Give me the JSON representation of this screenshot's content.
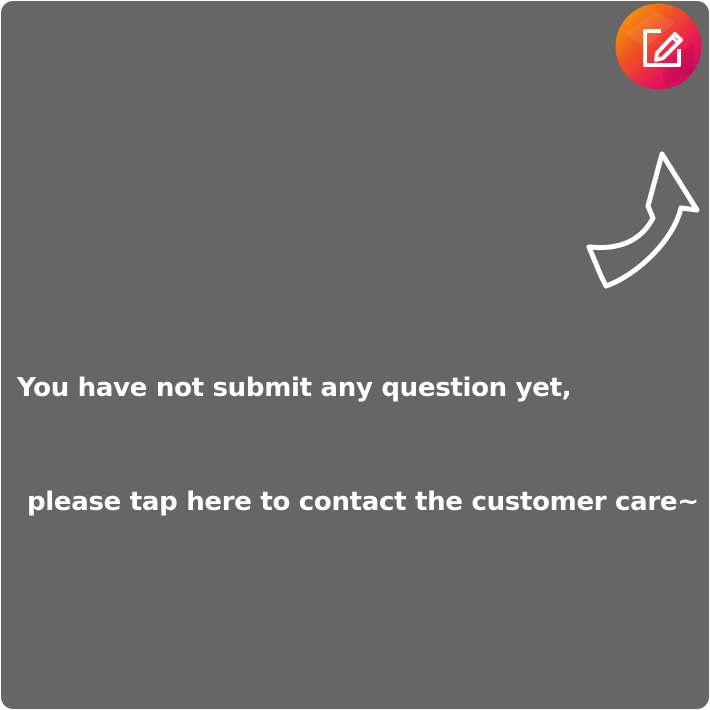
{
  "overlay": {
    "background": "#666666",
    "hint_line_1": "You have not submit any question yet,",
    "hint_line_2": "please tap here to contact the customer care~"
  },
  "compose_button": {
    "icon": "edit-icon",
    "gradient": [
      "#f0b000",
      "#ee3a22",
      "#e2005a",
      "#c2006e"
    ]
  },
  "pointer_arrow": {
    "icon": "curved-arrow-icon",
    "color": "#ffffff"
  }
}
